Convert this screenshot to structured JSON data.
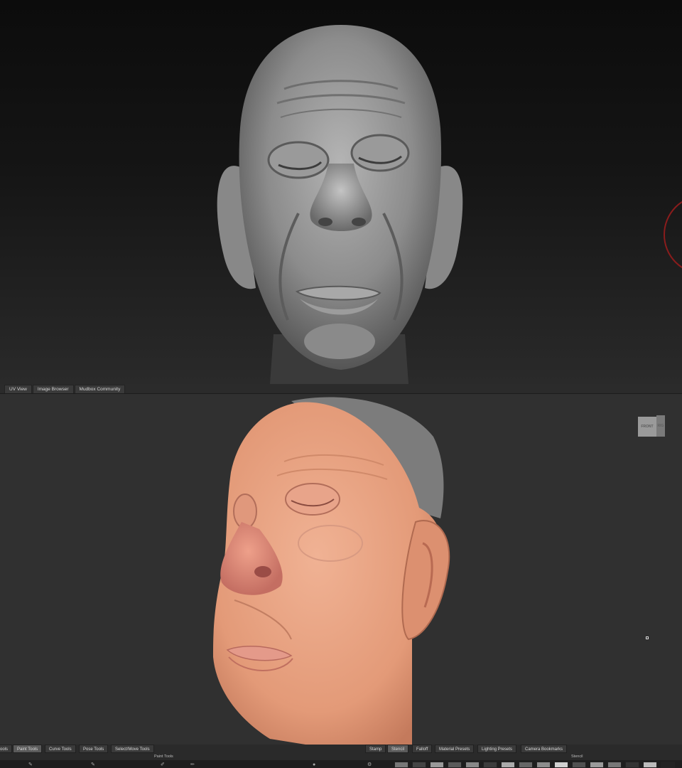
{
  "viewport_tabs": [
    "UV View",
    "Image Browser",
    "Mudbox Community"
  ],
  "viewcube": {
    "front": "FRONT",
    "side": "RIG"
  },
  "tool_tabs": [
    {
      "label": "ools",
      "active": false
    },
    {
      "label": "Paint Tools",
      "active": true
    },
    {
      "label": "Curve Tools",
      "active": false
    },
    {
      "label": "Pose Tools",
      "active": false
    },
    {
      "label": "Select/Move Tools",
      "active": false
    }
  ],
  "tray_tabs": [
    {
      "label": "Stamp",
      "active": false
    },
    {
      "label": "Stencil",
      "active": true
    },
    {
      "label": "Falloff",
      "active": false
    },
    {
      "label": "Material Presets",
      "active": false
    },
    {
      "label": "Lighting Presets",
      "active": false
    },
    {
      "label": "Camera Bookmarks",
      "active": false
    }
  ],
  "left_tray_label": "Paint Tools",
  "right_tray_label": "Stencil",
  "colors": {
    "sculpt_gray": "#9a9a9a",
    "skin": "#e8a07a",
    "viewport_bg": "#303030",
    "active_tab": "#5a5a5a"
  }
}
